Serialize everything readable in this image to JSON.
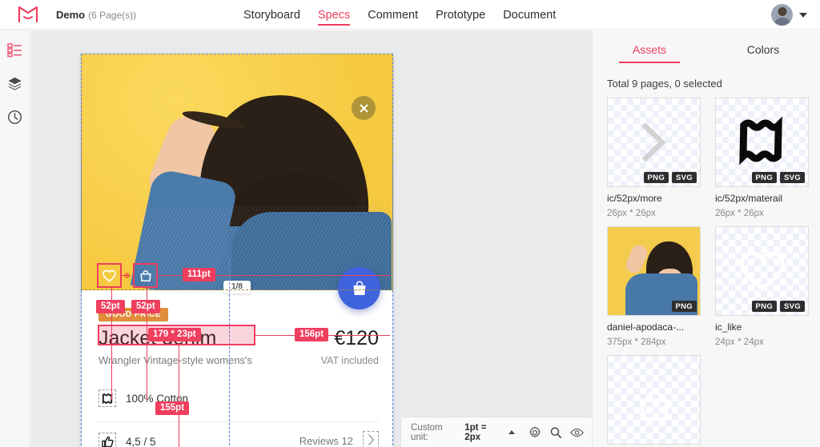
{
  "topbar": {
    "logo_icon": "pinkbox-logo-icon",
    "title": "Demo",
    "pages_label": "(6 Page(s))",
    "nav": [
      {
        "label": "Storyboard",
        "active": false
      },
      {
        "label": "Specs",
        "active": true
      },
      {
        "label": "Comment",
        "active": false
      },
      {
        "label": "Prototype",
        "active": false
      },
      {
        "label": "Document",
        "active": false
      }
    ],
    "avatar_icon": "user-avatar",
    "caret_icon": "chevron-down-icon"
  },
  "left_rail": [
    {
      "name": "specs-icon",
      "label": "Specs",
      "active": true
    },
    {
      "name": "layers-icon",
      "label": "Layers",
      "active": false
    },
    {
      "name": "history-icon",
      "label": "History",
      "active": false
    }
  ],
  "artboard": {
    "hero": {
      "close_icon": "close-icon",
      "page_indicator": "1/8",
      "fab_icon": "shopping-bag-icon"
    },
    "badge": "GOOD PRICE",
    "title": "Jacket denim",
    "price": "€120",
    "subtitle": "Wrangler Vintage-style womens's",
    "vat": "VAT included",
    "material_icon": "material-icon",
    "material": "100% Cotton",
    "rating_icon": "thumbs-up-icon",
    "rating": "4,5 / 5",
    "reviews": "Reviews 12",
    "chevron_icon": "chevron-right-icon"
  },
  "measurements": [
    {
      "value": "111pt",
      "name": "measure-111pt"
    },
    {
      "value": "52pt",
      "name": "measure-52pt-left"
    },
    {
      "value": "52pt",
      "name": "measure-52pt-right"
    },
    {
      "value": "179 * 23pt",
      "name": "measure-size-179x23pt"
    },
    {
      "value": "156pt",
      "name": "measure-156pt"
    },
    {
      "value": "155pt",
      "name": "measure-155pt"
    }
  ],
  "bottom_toolbar": {
    "unit_label": "Custom unit:",
    "unit_value": "1pt = 2px",
    "caret_icon": "caret-up-icon",
    "settings_icon": "gear-icon",
    "zoom_icon": "magnifier-icon",
    "preview_icon": "eye-icon"
  },
  "right_panel": {
    "tabs": [
      {
        "label": "Assets",
        "active": true
      },
      {
        "label": "Colors",
        "active": false
      }
    ],
    "total": "Total 9 pages, 0 selected",
    "assets": [
      {
        "name": "ic/52px/more",
        "size": "26px * 26px",
        "formats": [
          "PNG",
          "SVG"
        ],
        "thumb": "chevron-right-glyph"
      },
      {
        "name": "ic/52px/materail",
        "size": "26px * 26px",
        "formats": [
          "PNG",
          "SVG"
        ],
        "thumb": "material-glyph"
      },
      {
        "name": "daniel-apodaca-...",
        "size": "375px * 284px",
        "formats": [
          "PNG"
        ],
        "thumb": "photo"
      },
      {
        "name": "ic_like",
        "size": "24px * 24px",
        "formats": [
          "PNG",
          "SVG"
        ],
        "thumb": "heart-glyph"
      },
      {
        "name": "",
        "size": "",
        "formats": [],
        "thumb": "partial"
      }
    ]
  },
  "colors": {
    "accent": "#ef3e5e",
    "measure": "#ef3e5e",
    "fab": "#3f63dd",
    "hero_bg": "#f6cf4d",
    "badge": "#e08e3c"
  }
}
